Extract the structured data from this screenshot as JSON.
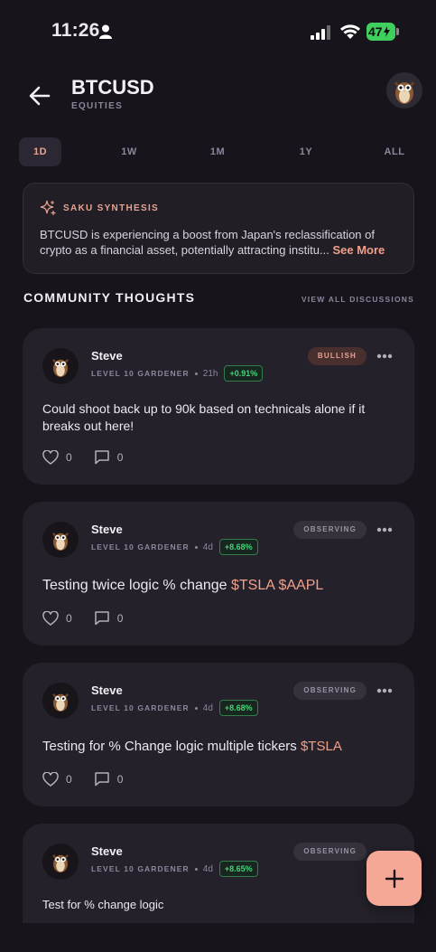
{
  "status_bar": {
    "time": "11:26",
    "battery": "47"
  },
  "header": {
    "ticker": "BTCUSD",
    "category": "EQUITIES"
  },
  "range_tabs": [
    "1D",
    "1W",
    "1M",
    "1Y",
    "ALL"
  ],
  "active_range": "1D",
  "synthesis": {
    "label": "SAKU SYNTHESIS",
    "text": "BTCUSD is experiencing a boost from Japan's reclassification of crypto as a financial asset, potentially attracting institu...",
    "see_more": "See More"
  },
  "community": {
    "title": "COMMUNITY THOUGHTS",
    "view_all": "VIEW ALL DISCUSSIONS"
  },
  "posts": [
    {
      "author": "Steve",
      "level": "LEVEL 10 GARDENER",
      "age": "21h",
      "change": "+0.91%",
      "sentiment": "BULLISH",
      "body": "Could shoot back up to 90k based on technicals alone if it breaks out here!",
      "body_tags": "",
      "likes": "0",
      "comments": "0"
    },
    {
      "author": "Steve",
      "level": "LEVEL 10 GARDENER",
      "age": "4d",
      "change": "+8.68%",
      "sentiment": "OBSERVING",
      "body": "Testing twice logic % change ",
      "body_tags": "$TSLA $AAPL",
      "likes": "0",
      "comments": "0"
    },
    {
      "author": "Steve",
      "level": "LEVEL 10 GARDENER",
      "age": "4d",
      "change": "+8.68%",
      "sentiment": "OBSERVING",
      "body": "Testing for % Change logic multiple tickers ",
      "body_tags": "$TSLA",
      "likes": "0",
      "comments": "0"
    },
    {
      "author": "Steve",
      "level": "LEVEL 10 GARDENER",
      "age": "4d",
      "change": "+8.65%",
      "sentiment": "OBSERVING",
      "body": "Test for % change logic",
      "body_tags": "",
      "likes": "",
      "comments": ""
    }
  ],
  "colors": {
    "accent": "#f0a08b",
    "positive": "#49d17a",
    "background": "#17141c",
    "card": "#24212a"
  },
  "icons": [
    "back-arrow-icon",
    "sparkle-icon",
    "heart-icon",
    "comment-icon",
    "more-icon",
    "plus-icon",
    "owl-avatar-icon"
  ]
}
